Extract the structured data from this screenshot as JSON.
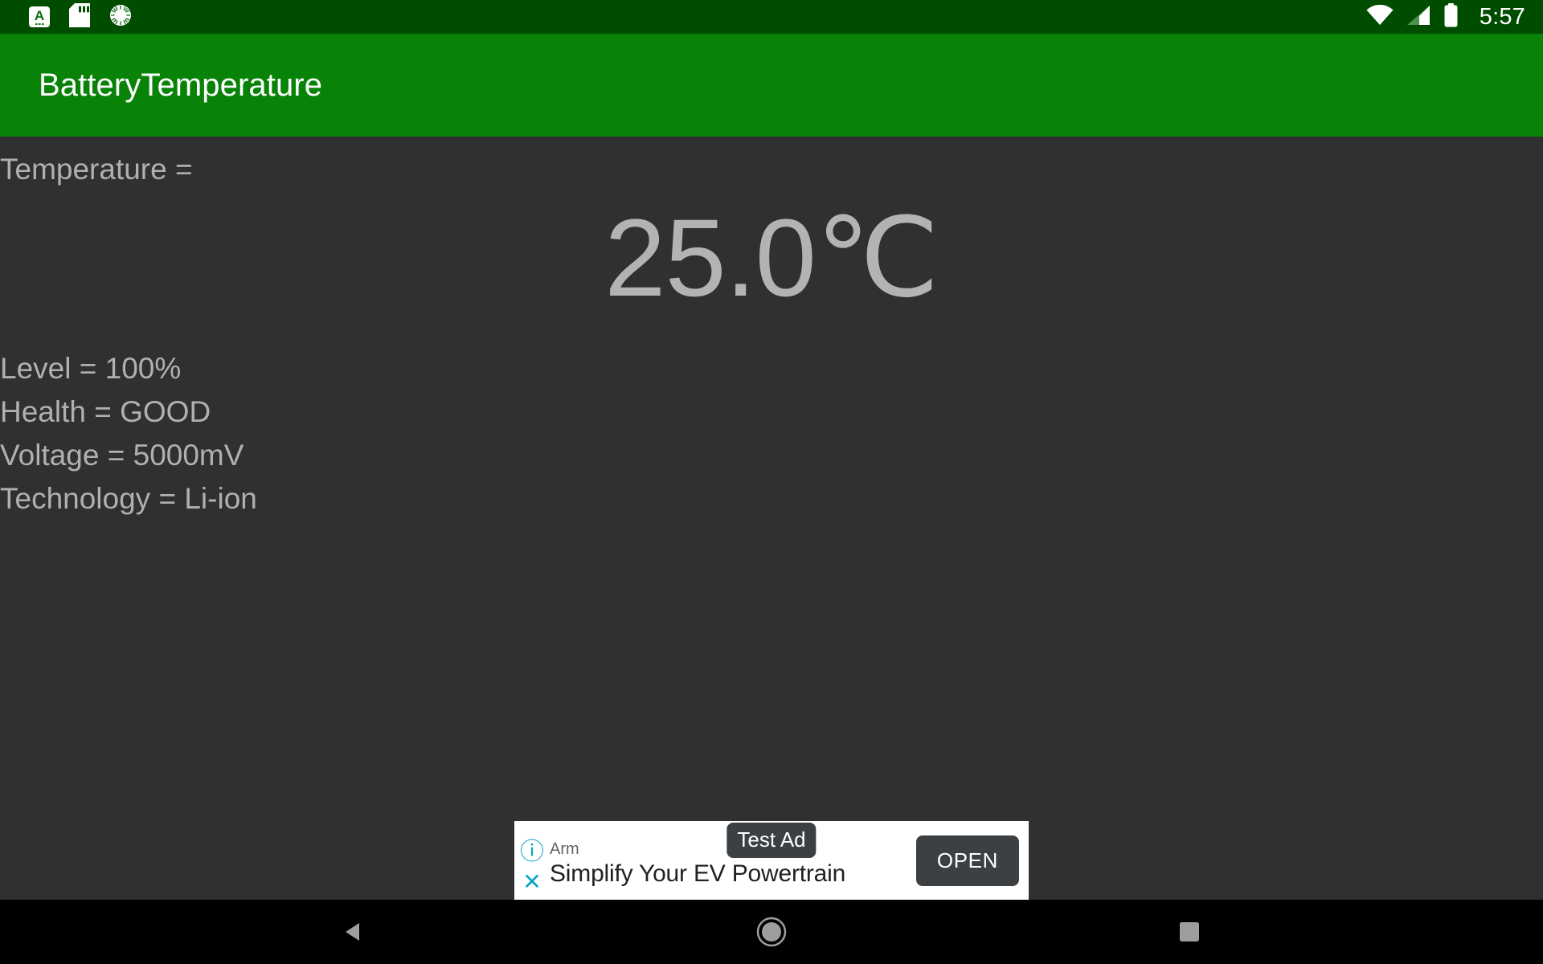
{
  "status_bar": {
    "background_color": "#004d00",
    "time": "5:57",
    "left_icons": [
      {
        "name": "input-method-icon",
        "glyph": "A"
      },
      {
        "name": "sd-card-icon",
        "glyph": "sd-card"
      },
      {
        "name": "alarm-gear-icon",
        "glyph": "gear"
      }
    ],
    "right_icons": [
      {
        "name": "wifi-icon",
        "label": "wifi-full"
      },
      {
        "name": "cellular-signal-icon",
        "label": "signal-partial"
      },
      {
        "name": "battery-icon",
        "label": "battery-full"
      }
    ]
  },
  "action_bar": {
    "title": "BatteryTemperature",
    "background_color": "#088308",
    "title_color": "#ffffff"
  },
  "main": {
    "background_color": "#303030",
    "text_color": "#b0b0b0",
    "temperature_label": "Temperature =",
    "temperature_value": "25.0℃",
    "details": [
      "Level = 100%",
      "Health = GOOD",
      "Voltage = 5000mV",
      "Technology = Li-ion"
    ]
  },
  "ad": {
    "test_badge": "Test Ad",
    "advertiser": "Arm",
    "headline": "Simplify Your EV Powertrain",
    "cta_label": "OPEN",
    "info_glyph": "ⓘ",
    "close_glyph": "✕",
    "icon_color": "#09a4c4",
    "background_color": "#ffffff"
  },
  "nav_bar": {
    "background_color": "#000000",
    "buttons": [
      {
        "name": "back-button",
        "shape": "triangle-left"
      },
      {
        "name": "home-button",
        "shape": "circle"
      },
      {
        "name": "recents-button",
        "shape": "square"
      }
    ]
  }
}
